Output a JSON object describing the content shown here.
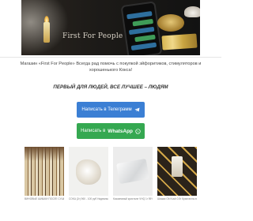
{
  "banner": {
    "brand_text": "First For People"
  },
  "intro": {
    "description": "Магазин «First For People» Всегда рад помочь с покупкой  эйфоритиков, стимуляторов и хорошенького Кокса!",
    "slogan": "ПЕРВЫЙ ДЛЯ ЛЮДЕЙ, ВСЕ ЛУЧШЕЕ – ЛЮДЯМ"
  },
  "buttons": {
    "telegram_label": "Написать в Телеграмм",
    "whatsapp_prefix": "Написать в",
    "whatsapp_name": "WhatsApp",
    "colors": {
      "telegram": "#3b7fd4",
      "whatsapp": "#35a851"
    },
    "icons": {
      "telegram": "telegram-icon",
      "whatsapp": "whatsapp-icon"
    }
  },
  "products": [
    {
      "caption": "ВИНОВЫЕ ШИШКИ ПОСЛЕ СУШКИ (ОСКАР) 0.5 гр."
    },
    {
      "caption": "COKA (2г) 960 - 100 руб Надежный Кокс!"
    },
    {
      "caption": "Кокаиновый кристалл VHQ 1г 95% чистоты"
    },
    {
      "caption": "Шишки Ob Kush 0.5г Кристаллы высшего качества"
    }
  ]
}
